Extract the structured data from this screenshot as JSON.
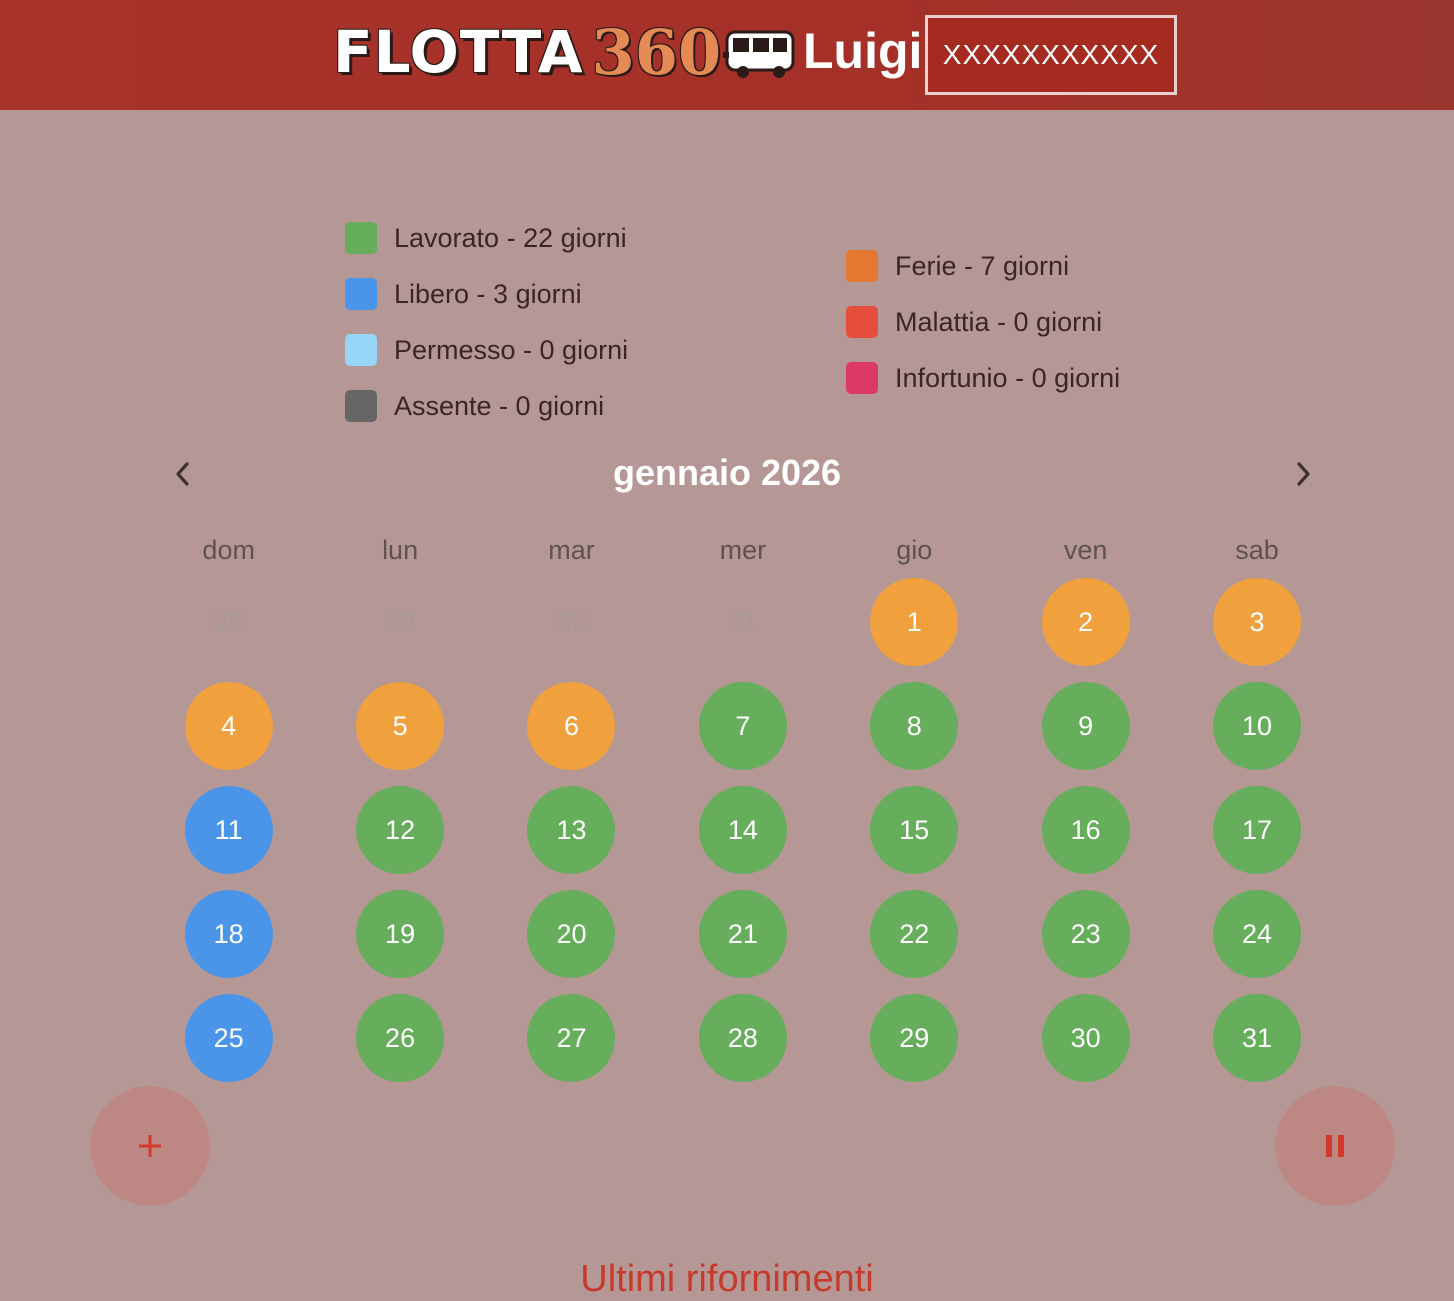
{
  "header": {
    "logo_text": "FLOTTA",
    "logo_number": "360",
    "user_name": "Luigi",
    "user_code": "XXXXXXXXXXX"
  },
  "legend": {
    "left": [
      {
        "label": "Lavorato - 22 giorni",
        "color": "#66ad5c"
      },
      {
        "label": "Libero - 3 giorni",
        "color": "#4a95e8"
      },
      {
        "label": "Permesso - 0 giorni",
        "color": "#96d4f8"
      },
      {
        "label": "Assente - 0 giorni",
        "color": "#666666"
      }
    ],
    "right": [
      {
        "label": "Ferie - 7 giorni",
        "color": "#e57830"
      },
      {
        "label": "Malattia - 0 giorni",
        "color": "#e54e3c"
      },
      {
        "label": "Infortunio - 0 giorni",
        "color": "#dc3a64"
      }
    ]
  },
  "calendar": {
    "month_label": "gennaio 2026",
    "prev_icon": "chevron-left-icon",
    "next_icon": "chevron-right-icon",
    "weekdays": [
      "dom",
      "lun",
      "mar",
      "mer",
      "gio",
      "ven",
      "sab"
    ],
    "status_colors": {
      "ferie": "#f0a03c",
      "lavorato": "#66ad5c",
      "libero": "#4a95e8"
    },
    "days": [
      {
        "label": "28",
        "status": "outside"
      },
      {
        "label": "29",
        "status": "outside"
      },
      {
        "label": "30",
        "status": "outside"
      },
      {
        "label": "31",
        "status": "outside"
      },
      {
        "label": "1",
        "status": "ferie"
      },
      {
        "label": "2",
        "status": "ferie"
      },
      {
        "label": "3",
        "status": "ferie"
      },
      {
        "label": "4",
        "status": "ferie"
      },
      {
        "label": "5",
        "status": "ferie"
      },
      {
        "label": "6",
        "status": "ferie"
      },
      {
        "label": "7",
        "status": "lavorato"
      },
      {
        "label": "8",
        "status": "lavorato"
      },
      {
        "label": "9",
        "status": "lavorato"
      },
      {
        "label": "10",
        "status": "lavorato"
      },
      {
        "label": "11",
        "status": "libero"
      },
      {
        "label": "12",
        "status": "lavorato"
      },
      {
        "label": "13",
        "status": "lavorato"
      },
      {
        "label": "14",
        "status": "lavorato"
      },
      {
        "label": "15",
        "status": "lavorato"
      },
      {
        "label": "16",
        "status": "lavorato"
      },
      {
        "label": "17",
        "status": "lavorato"
      },
      {
        "label": "18",
        "status": "libero"
      },
      {
        "label": "19",
        "status": "lavorato"
      },
      {
        "label": "20",
        "status": "lavorato"
      },
      {
        "label": "21",
        "status": "lavorato"
      },
      {
        "label": "22",
        "status": "lavorato"
      },
      {
        "label": "23",
        "status": "lavorato"
      },
      {
        "label": "24",
        "status": "lavorato"
      },
      {
        "label": "25",
        "status": "libero"
      },
      {
        "label": "26",
        "status": "lavorato"
      },
      {
        "label": "27",
        "status": "lavorato"
      },
      {
        "label": "28",
        "status": "lavorato"
      },
      {
        "label": "29",
        "status": "lavorato"
      },
      {
        "label": "30",
        "status": "lavorato"
      },
      {
        "label": "31",
        "status": "lavorato"
      }
    ]
  },
  "actions": {
    "add_icon": "plus-icon",
    "pause_icon": "pause-icon",
    "icon_color": "#d4382a"
  },
  "section": {
    "title": "Ultimi rifornimenti"
  }
}
